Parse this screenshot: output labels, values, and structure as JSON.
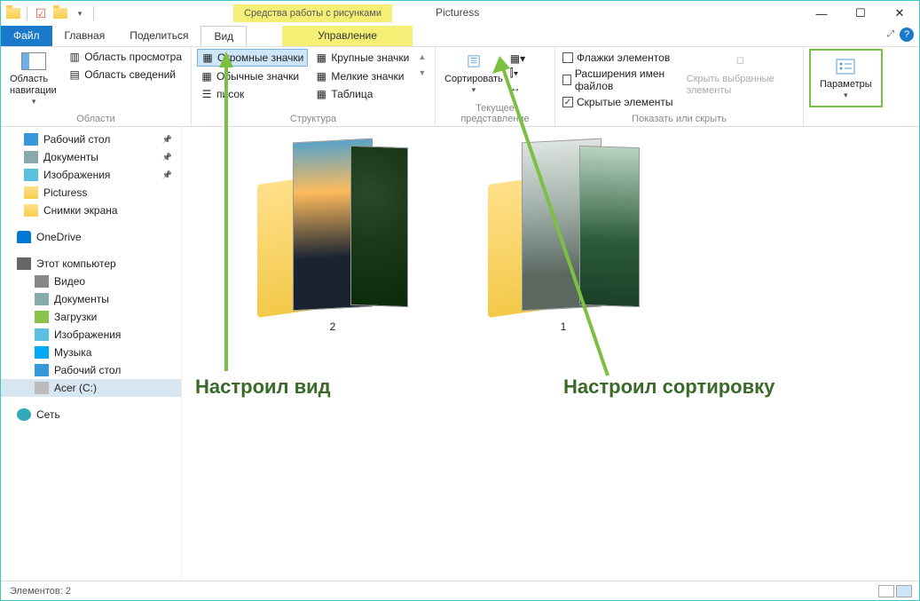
{
  "window": {
    "context_tab": "Средства работы с рисунками",
    "title": "Picturess",
    "minimize": "—",
    "maximize": "☐",
    "close": "✕"
  },
  "tabs": {
    "file": "Файл",
    "home": "Главная",
    "share": "Поделиться",
    "view": "Вид",
    "manage": "Управление"
  },
  "ribbon": {
    "nav_pane": "Область навигации",
    "preview_pane": "Область просмотра",
    "details_pane": "Область сведений",
    "group_panes": "Области",
    "huge_icons": "Огромные значки",
    "large_icons": "Крупные значки",
    "normal_icons": "Обычные значки",
    "small_icons": "Мелкие значки",
    "list": "писок",
    "tiles": "Таблица",
    "group_layout": "Структура",
    "sort": "Сортировать",
    "group_current": "Текущее представление",
    "chk_item_checkboxes": "Флажки элементов",
    "chk_file_ext": "Расширения имен файлов",
    "chk_hidden": "Скрытые элементы",
    "hide_selected": "Скрыть выбранные элементы",
    "group_show": "Показать или скрыть",
    "options": "Параметры"
  },
  "tree": {
    "desktop": "Рабочий стол",
    "documents": "Документы",
    "pictures": "Изображения",
    "picturess": "Picturess",
    "screenshots": "Снимки экрана",
    "onedrive": "OneDrive",
    "this_pc": "Этот компьютер",
    "video": "Видео",
    "documents2": "Документы",
    "downloads": "Загрузки",
    "pictures2": "Изображения",
    "music": "Музыка",
    "desktop2": "Рабочий стол",
    "acer": "Acer (C:)",
    "network": "Сеть"
  },
  "content": {
    "folder1": "2",
    "folder2": "1"
  },
  "annotations": {
    "view": "Настроил вид",
    "sort": "Настроил сортировку"
  },
  "status": {
    "items": "Элементов: 2"
  }
}
